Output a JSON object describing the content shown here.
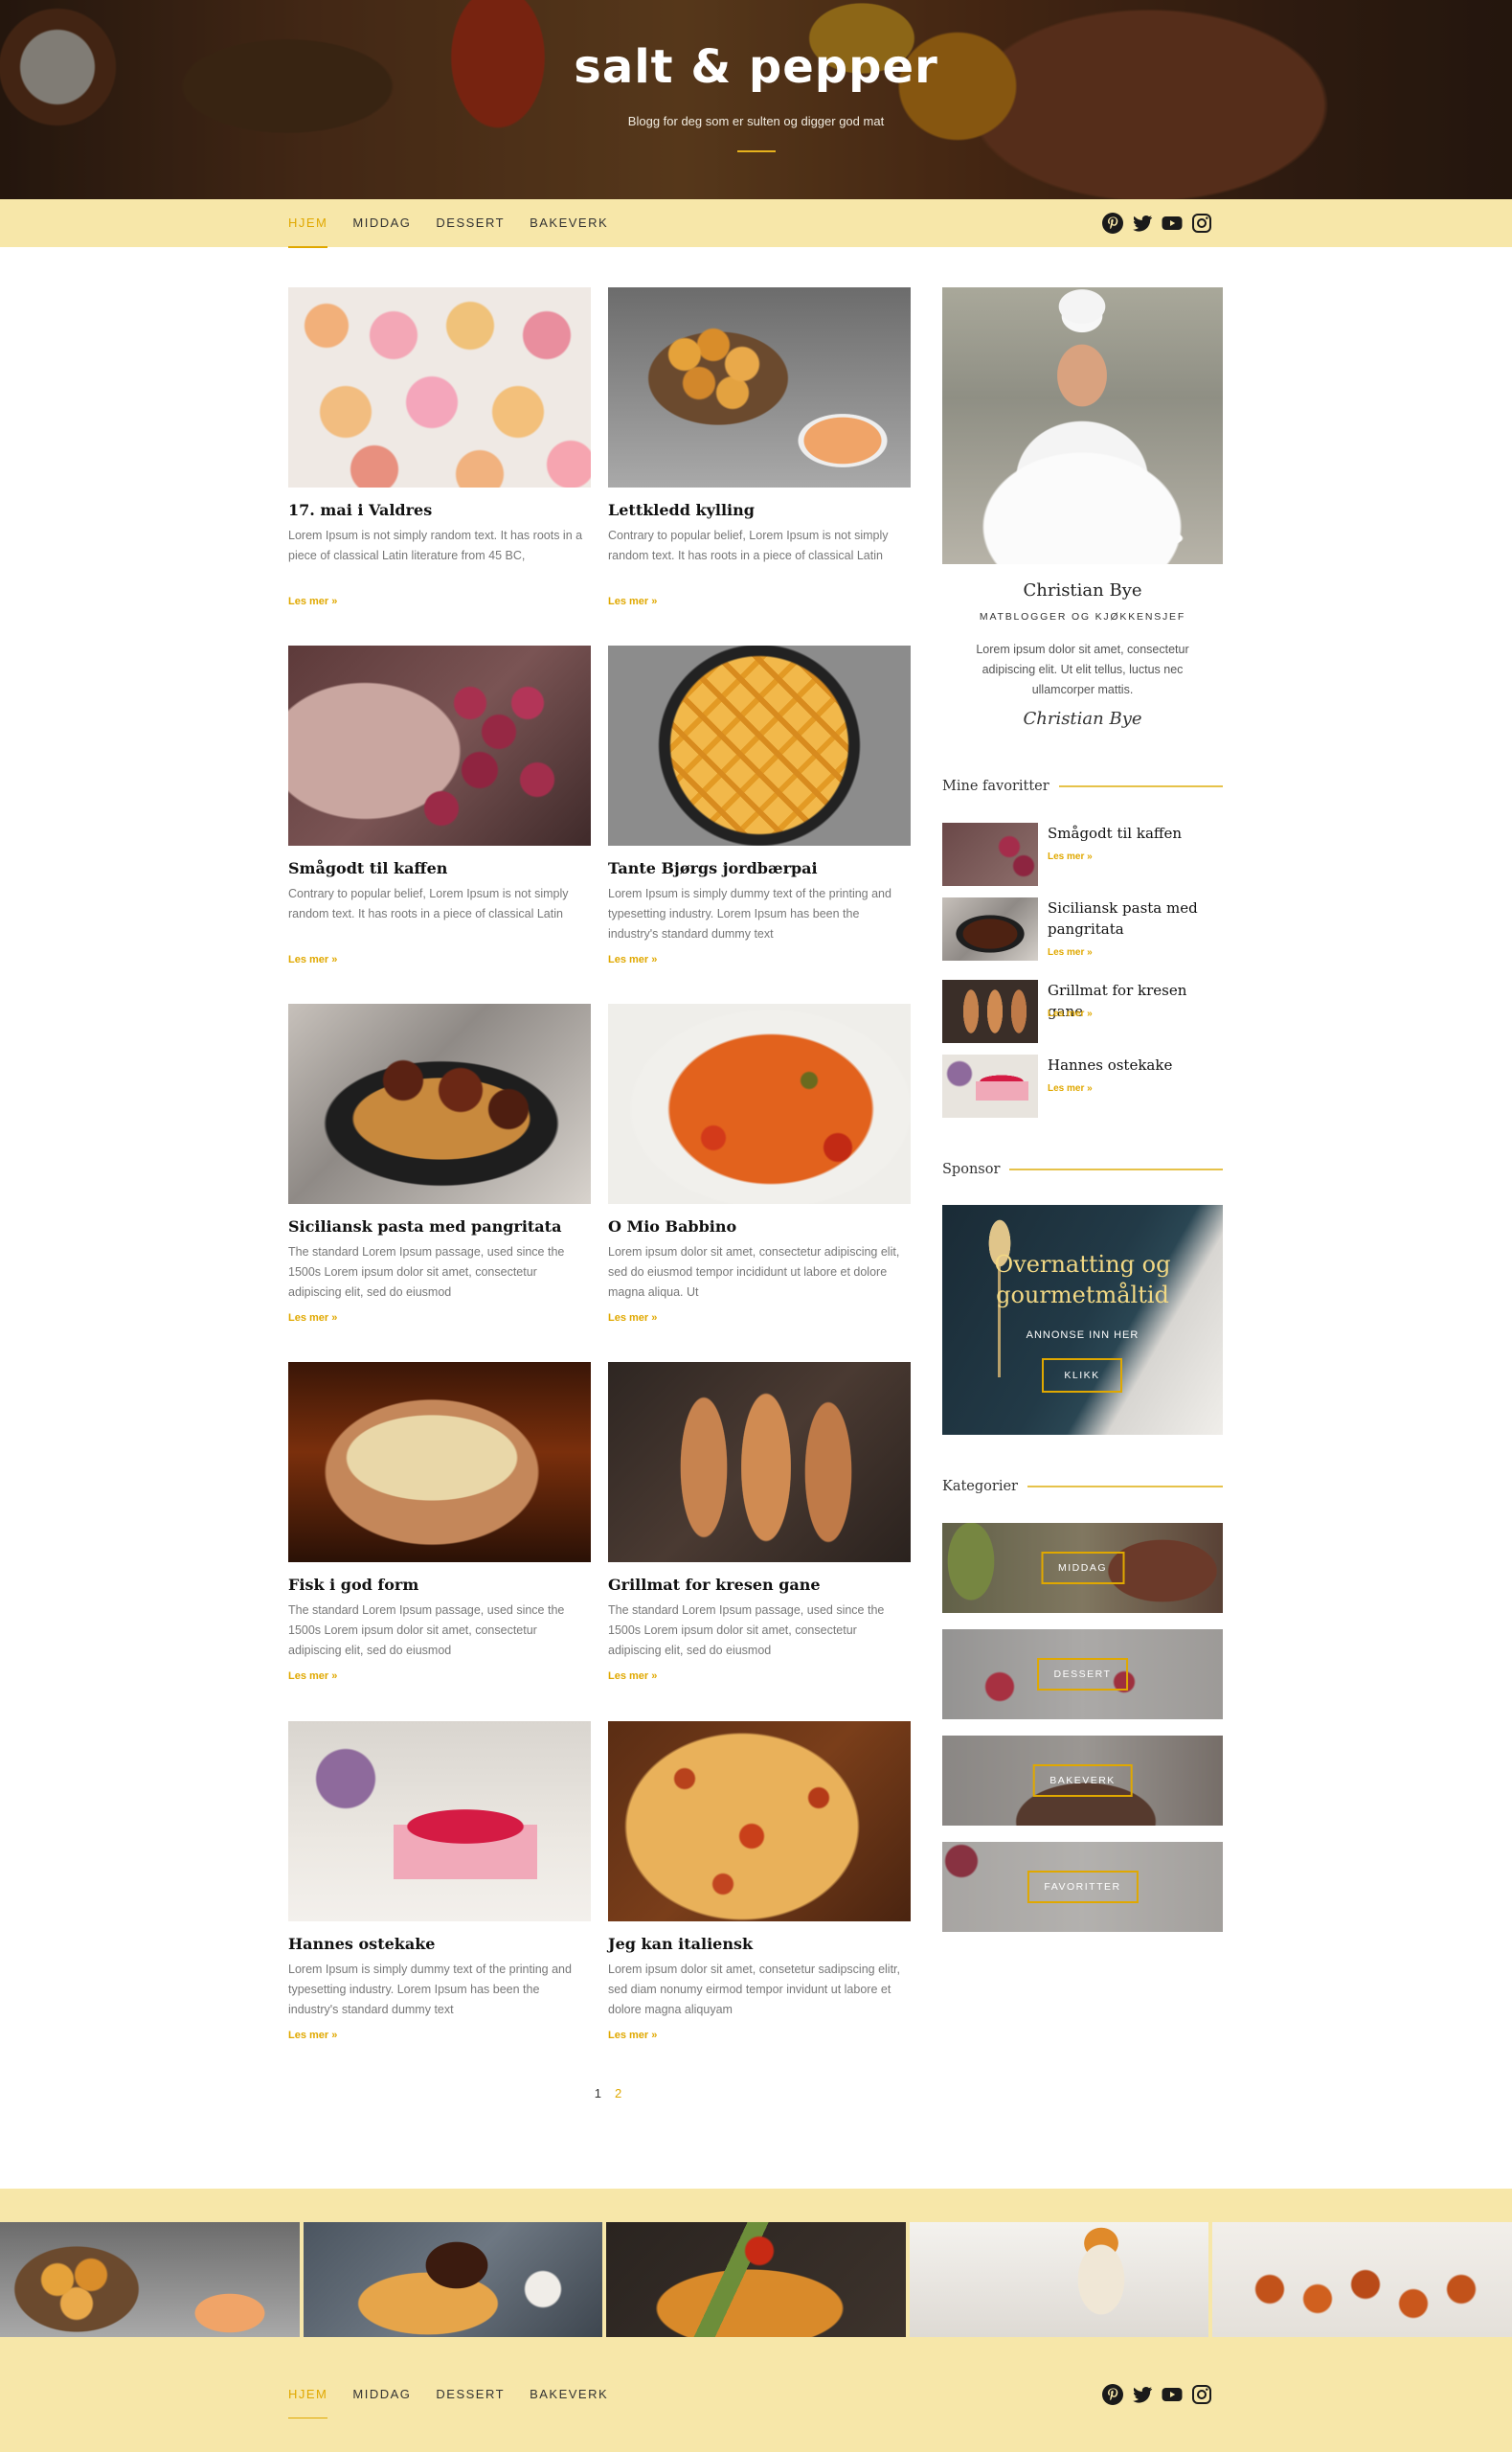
{
  "site": {
    "logo": "salt & pepper",
    "tagline": "Blogg for deg som er sulten og digger god mat"
  },
  "nav": {
    "items": [
      {
        "label": "HJEM",
        "active": true
      },
      {
        "label": "MIDDAG",
        "active": false
      },
      {
        "label": "DESSERT",
        "active": false
      },
      {
        "label": "BAKEVERK",
        "active": false
      }
    ],
    "social": [
      "pinterest-icon",
      "twitter-icon",
      "youtube-icon",
      "instagram-icon"
    ]
  },
  "posts": [
    {
      "title": "17. mai i Valdres",
      "excerpt": "Lorem Ipsum is not simply random text. It has roots in a piece of classical Latin literature from 45 BC,",
      "more": "Les mer »"
    },
    {
      "title": "Lettkledd kylling",
      "excerpt": "Contrary to popular belief, Lorem Ipsum is not simply random text. It has roots in a piece of classical Latin",
      "more": "Les mer »"
    },
    {
      "title": "Smågodt til kaffen",
      "excerpt": "Contrary to popular belief, Lorem Ipsum is not simply random text. It has roots in a piece of classical Latin",
      "more": "Les mer »"
    },
    {
      "title": "Tante Bjørgs jordbærpai",
      "excerpt": "Lorem Ipsum is simply dummy text of the printing and typesetting industry. Lorem Ipsum has been the industry's standard dummy text",
      "more": "Les mer »"
    },
    {
      "title": "Siciliansk pasta med pangritata",
      "excerpt": "The standard Lorem Ipsum passage, used since the 1500s Lorem ipsum dolor sit amet, consectetur adipiscing elit, sed do eiusmod",
      "more": "Les mer »"
    },
    {
      "title": "O Mio Babbino",
      "excerpt": "Lorem ipsum dolor sit amet, consectetur adipiscing elit, sed do eiusmod tempor incididunt ut labore et dolore magna aliqua. Ut",
      "more": "Les mer »"
    },
    {
      "title": "Fisk i god form",
      "excerpt": "The standard Lorem Ipsum passage, used since the 1500s Lorem ipsum dolor sit amet, consectetur adipiscing elit, sed do eiusmod",
      "more": "Les mer »"
    },
    {
      "title": "Grillmat for kresen gane",
      "excerpt": "The standard Lorem Ipsum passage, used since the 1500s Lorem ipsum dolor sit amet, consectetur adipiscing elit, sed do eiusmod",
      "more": "Les mer »"
    },
    {
      "title": "Hannes ostekake",
      "excerpt": "Lorem Ipsum is simply dummy text of the printing and typesetting industry. Lorem Ipsum has been the industry's standard dummy text",
      "more": "Les mer »"
    },
    {
      "title": "Jeg kan italiensk",
      "excerpt": "Lorem ipsum dolor sit amet, consetetur sadipscing elitr, sed diam nonumy eirmod tempor invidunt ut labore et dolore magna aliquyam",
      "more": "Les mer »"
    }
  ],
  "author": {
    "name": "Christian Bye",
    "role": "MATBLOGGER OG KJØKKENSJEF",
    "bio": "Lorem ipsum dolor sit amet, consectetur adipiscing elit. Ut elit tellus, luctus nec ullamcorper mattis.",
    "signature": "Christian Bye"
  },
  "favorites": {
    "heading": "Mine favoritter",
    "items": [
      {
        "title": "Smågodt til kaffen",
        "more": "Les mer »"
      },
      {
        "title": "Siciliansk pasta med pangritata",
        "more": "Les mer »"
      },
      {
        "title": "Grillmat for kresen gane",
        "more": "Les mer »"
      },
      {
        "title": "Hannes ostekake",
        "more": "Les mer »"
      }
    ]
  },
  "sponsor": {
    "heading": "Sponsor",
    "title": "Overnatting og gourmetmåltid",
    "subtitle": "ANNONSE INN HER",
    "button": "KLIKK"
  },
  "categories": {
    "heading": "Kategorier",
    "items": [
      "MIDDAG",
      "DESSERT",
      "BAKEVERK",
      "FAVORITTER"
    ]
  },
  "pagination": {
    "current": "1",
    "next": "2"
  },
  "colors": {
    "accent": "#e0a800",
    "band": "#f7e7a9"
  }
}
